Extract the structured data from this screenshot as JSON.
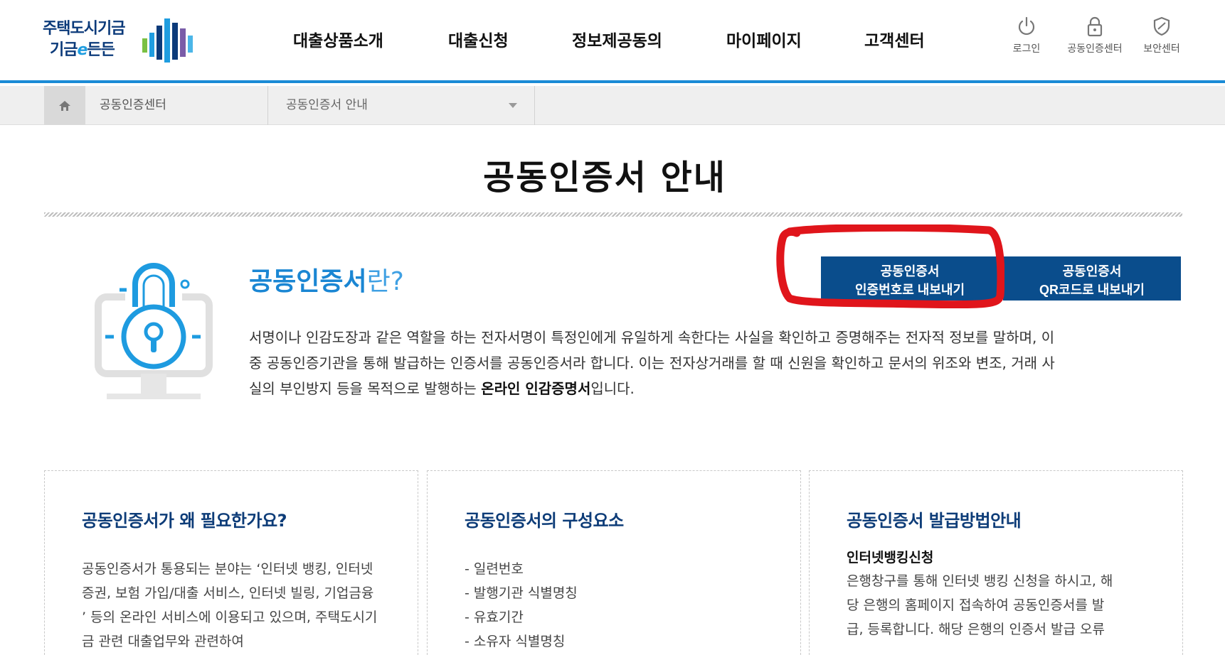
{
  "logo": {
    "line1": "주택도시기금",
    "line2_a": "기금",
    "line2_e": "e",
    "line2_b": "든든"
  },
  "gnb": [
    "대출상품소개",
    "대출신청",
    "정보제공동의",
    "마이페이지",
    "고객센터"
  ],
  "util": {
    "login": "로그인",
    "cert": "공동인증센터",
    "security": "보안센터"
  },
  "breadcrumb": {
    "home": "home-icon",
    "section": "공동인증센터",
    "current": "공동인증서 안내"
  },
  "page_title": "공동인증서 안내",
  "intro": {
    "heading_bold": "공동인증서",
    "heading_rest": "란?",
    "text_1": "서명이나 인감도장과 같은 역할을 하는 전자서명이 특정인에게 유일하게 속한다는 사실을 확인하고 증명해주는 전자적 정보를 말하며, 이중 공동인증기관을 통해 발급하는 인증서를 공동인증서라 합니다. 이는 전자상거래를 할 때 신원을 확인하고 문서의 위조와 변조, 거래 사실의 부인방지 등을 목적으로 발행하는 ",
    "text_bold": "온라인 인감증명서",
    "text_2": "입니다."
  },
  "buttons": {
    "export_code_l1": "공동인증서",
    "export_code_l2": "인증번호로 내보내기",
    "export_qr_l1": "공동인증서",
    "export_qr_l2": "QR코드로 내보내기"
  },
  "cards": {
    "why": {
      "title": "공동인증서가 왜 필요한가요?",
      "text": "공동인증서가 통용되는 분야는 ‘인터넷 뱅킹, 인터넷 증권, 보험 가입/대출 서비스, 인터넷 빌링, 기업금융 ’ 등의 온라인 서비스에 이용되고 있으며, 주택도시기금 관련 대출업무와 관련하여"
    },
    "parts": {
      "title": "공동인증서의 구성요소",
      "items": [
        "- 일련번호",
        "- 발행기관 식별명칭",
        "- 유효기간",
        "- 소유자 식별명칭"
      ]
    },
    "issue": {
      "title": "공동인증서 발급방법안내",
      "subtitle": "인터넷뱅킹신청",
      "text": "은행창구를 통해 인터넷 뱅킹 신청을 하시고, 해당 은행의 홈페이지 접속하여 공동인증서를 발급, 등록합니다. 해당 은행의 인증서 발급 오류"
    }
  },
  "colors": {
    "brand_navy": "#0a4d8c",
    "accent_blue": "#1a8bd6",
    "annotation_red": "#e0151b"
  }
}
